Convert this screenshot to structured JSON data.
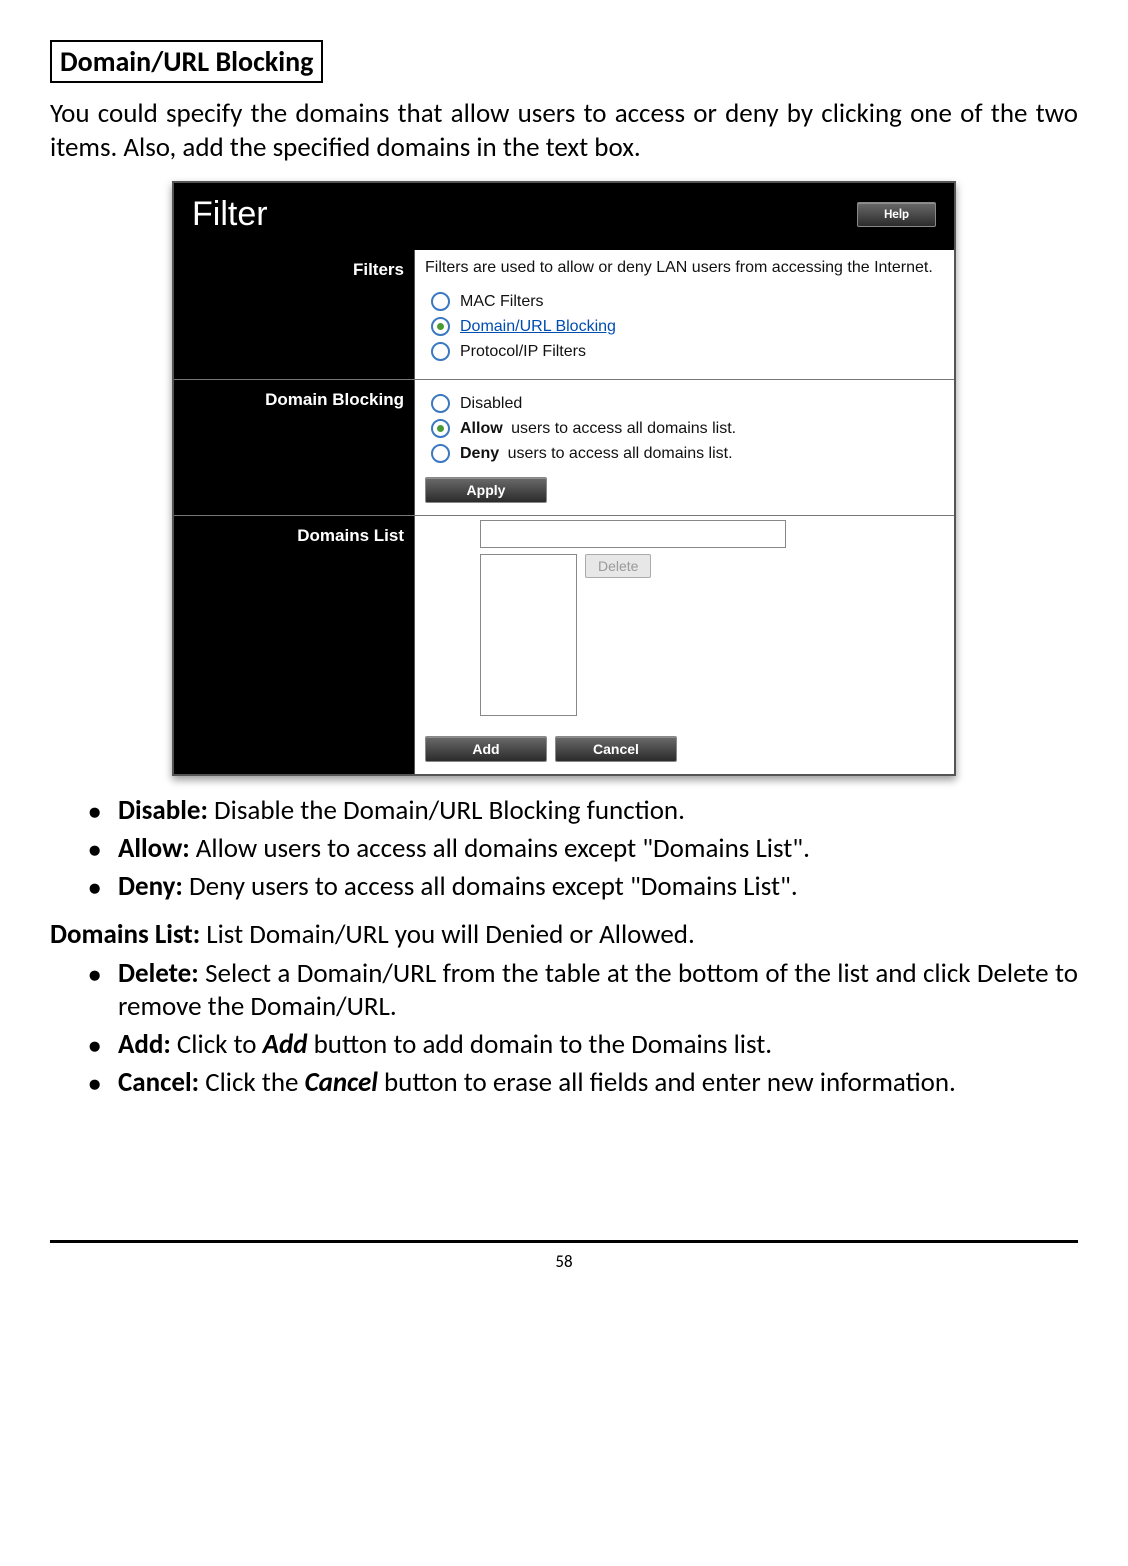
{
  "heading": "Domain/URL Blocking",
  "intro": "You could specify the domains that allow users to access or deny by clicking one of the two items.  Also, add the specified domains in the text box.",
  "screenshot": {
    "title": "Filter",
    "help_label": "Help",
    "rows": {
      "filters": {
        "label": "Filters",
        "desc": "Filters are used to allow or deny LAN users from accessing the Internet.",
        "options": {
          "mac": "MAC Filters",
          "domain": "Domain/URL Blocking",
          "protocol": "Protocol/IP Filters"
        }
      },
      "domain_blocking": {
        "label": "Domain Blocking",
        "options": {
          "disabled": "Disabled",
          "allow_bold": "Allow",
          "allow_rest": " users to access all domains list.",
          "deny_bold": "Deny",
          "deny_rest": " users to access all domains list."
        },
        "apply_label": "Apply"
      },
      "domains_list": {
        "label": "Domains List",
        "delete_label": "Delete",
        "add_label": "Add",
        "cancel_label": "Cancel"
      }
    }
  },
  "bullets1": {
    "disable_term": "Disable:",
    "disable_text": " Disable the Domain/URL Blocking function.",
    "allow_term": "Allow:",
    "allow_text": " Allow users to access all domains except \"Domains List\".",
    "deny_term": "Deny:",
    "deny_text": " Deny users to access all domains except \"Domains List\"."
  },
  "subhead_term": "Domains List:",
  "subhead_text": " List Domain/URL you will Denied or Allowed.",
  "bullets2": {
    "delete_term": "Delete:",
    "delete_text": " Select a Domain/URL from the table at the bottom of the list and click Delete to remove the Domain/URL.",
    "add_term": "Add:",
    "add_pre": " Click to ",
    "add_emph": "Add",
    "add_post": " button to add domain to the Domains list.",
    "cancel_term": "Cancel:",
    "cancel_pre": " Click the ",
    "cancel_emph": "Cancel",
    "cancel_post": " button to erase all fields and enter new information."
  },
  "page_number": "58"
}
